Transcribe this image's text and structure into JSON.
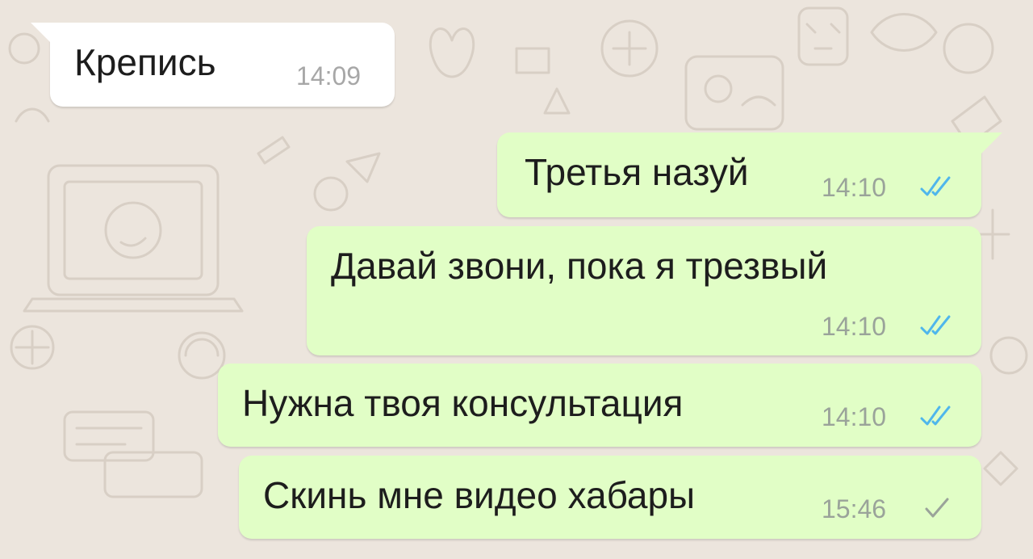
{
  "messages": [
    {
      "direction": "incoming",
      "text": "Крепись",
      "time": "14:09"
    },
    {
      "direction": "outgoing",
      "text": "Третья назуй",
      "time": "14:10",
      "status_icon": "double-check-read-icon"
    },
    {
      "direction": "outgoing",
      "text": "Давай звони, пока я трезвый",
      "time": "14:10",
      "status_icon": "double-check-read-icon"
    },
    {
      "direction": "outgoing",
      "text": "Нужна твоя консультация",
      "time": "14:10",
      "status_icon": "double-check-read-icon"
    },
    {
      "direction": "outgoing",
      "text": "Скинь мне видео хабары",
      "time": "15:46",
      "status_icon": "single-check-sent-icon"
    }
  ],
  "colors": {
    "background": "#ece5dd",
    "incoming_bubble": "#ffffff",
    "outgoing_bubble": "#e1fec6",
    "read_tick": "#4fb6ec",
    "sent_tick": "#9aa39a"
  }
}
